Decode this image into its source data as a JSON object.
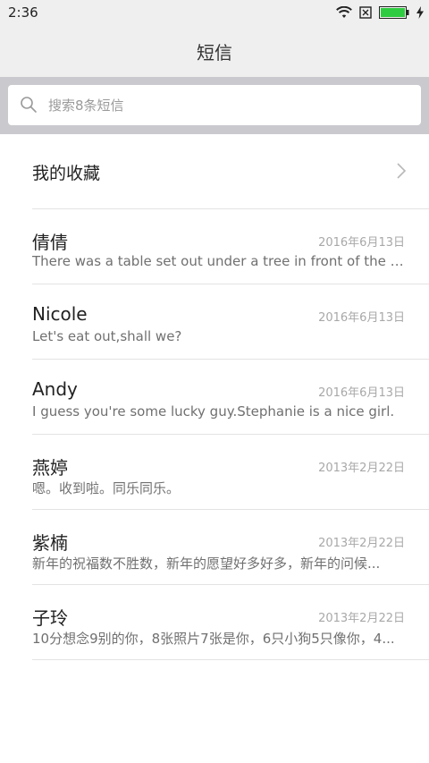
{
  "status_bar": {
    "time": "2:36",
    "icons": [
      "wifi-icon",
      "no-sim-icon",
      "battery-icon",
      "charging-icon"
    ],
    "battery_color": "#2ecc40"
  },
  "header": {
    "title": "短信"
  },
  "search": {
    "placeholder": "搜索8条短信"
  },
  "favorites": {
    "label": "我的收藏"
  },
  "messages": [
    {
      "name": "倩倩",
      "date": "2016年6月13日",
      "preview": "There was a table set out under a tree in front of the ho..."
    },
    {
      "name": "Nicole",
      "date": "2016年6月13日",
      "preview": "Let's eat out,shall we?"
    },
    {
      "name": "Andy",
      "date": "2016年6月13日",
      "preview": "I guess you're some lucky guy.Stephanie is a nice girl."
    },
    {
      "name": "燕婷",
      "date": "2013年2月22日",
      "preview": "嗯。收到啦。同乐同乐。"
    },
    {
      "name": "紫楠",
      "date": "2013年2月22日",
      "preview": "新年的祝福数不胜数，新年的愿望好多好多，新年的问候..."
    },
    {
      "name": "子玲",
      "date": "2013年2月22日",
      "preview": "10分想念9别的你，8张照片7张是你，6只小狗5只像你，4..."
    }
  ]
}
